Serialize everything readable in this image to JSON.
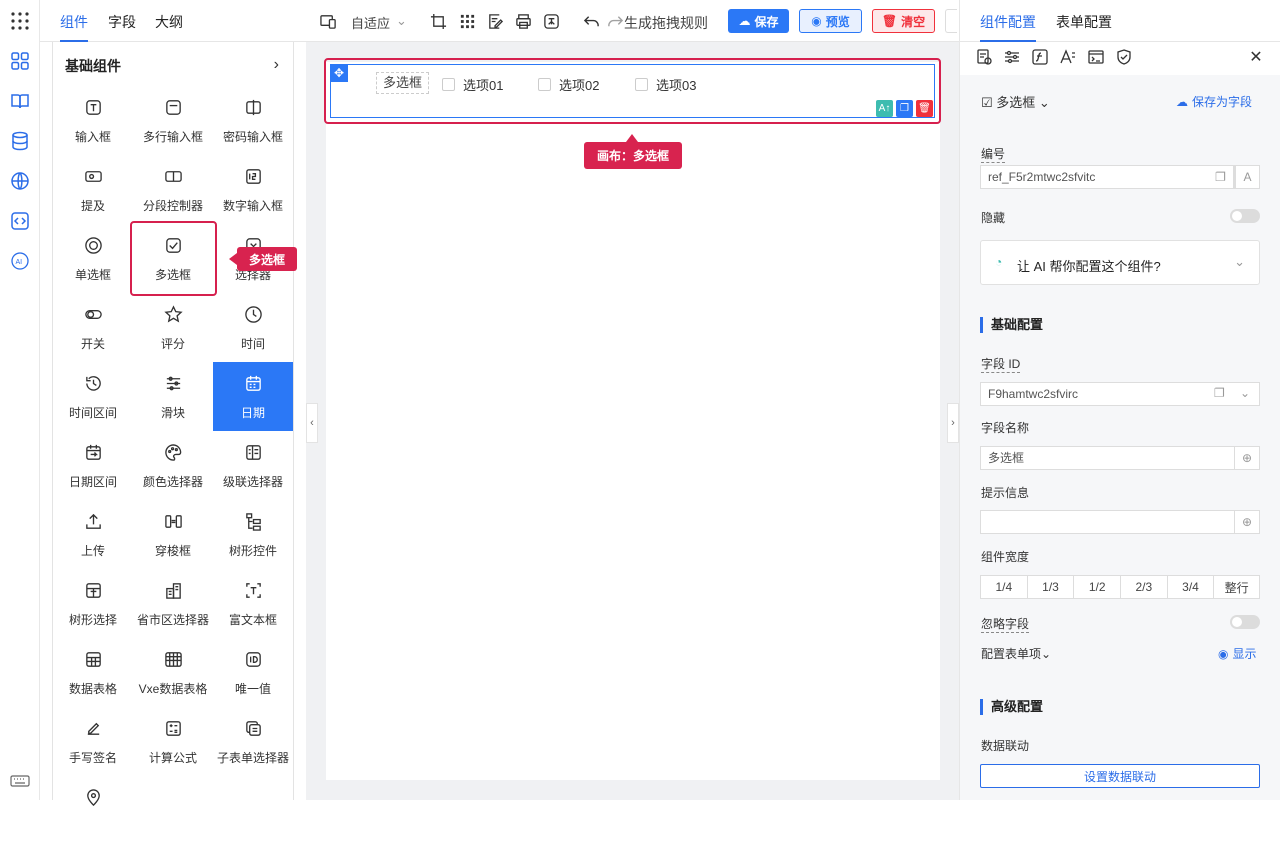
{
  "left_panel": {
    "tabs": [
      "组件",
      "字段",
      "大纲"
    ],
    "group_title": "基础组件",
    "items": [
      "输入框",
      "多行输入框",
      "密码输入框",
      "提及",
      "分段控制器",
      "数字输入框",
      "单选框",
      "多选框",
      "选择器",
      "开关",
      "评分",
      "时间",
      "时间区间",
      "滑块",
      "日期",
      "日期区间",
      "颜色选择器",
      "级联选择器",
      "上传",
      "穿梭框",
      "树形控件",
      "树形选择",
      "省市区选择器",
      "富文本框",
      "数据表格",
      "Vxe数据表格",
      "唯一值",
      "手写签名",
      "计算公式",
      "子表单选择器"
    ],
    "selected_item": "日期"
  },
  "callouts": {
    "palette": "多选框",
    "canvas": "画布：多选框"
  },
  "toolbar": {
    "layout_mode": "自适应",
    "rule_label": "生成拖拽规则",
    "save": "保存",
    "preview": "预览",
    "clear": "清空"
  },
  "canvas": {
    "field_label": "多选框",
    "options": [
      "选项01",
      "选项02",
      "选项03"
    ]
  },
  "right_panel": {
    "tabs": [
      "组件配置",
      "表单配置"
    ],
    "component_type": "多选框",
    "save_as_field": "保存为字段",
    "ref_label": "编号",
    "ref_value": "ref_F5r2mtwc2sfvitc",
    "hidden_label": "隐藏",
    "ai_prompt": "让 AI 帮你配置这个组件?",
    "basic_section": "基础配置",
    "field_id_label": "字段 ID",
    "field_id_value": "F9hamtwc2sfvirc",
    "field_name_label": "字段名称",
    "field_name_value": "多选框",
    "hint_label": "提示信息",
    "hint_value": "",
    "width_label": "组件宽度",
    "width_options": [
      "1/4",
      "1/3",
      "1/2",
      "2/3",
      "3/4",
      "整行"
    ],
    "ignore_label": "忽略字段",
    "config_items_label": "配置表单项",
    "show_label": "显示",
    "advanced_section": "高级配置",
    "linkage_label": "数据联动",
    "linkage_button": "设置数据联动"
  },
  "colors": {
    "primary": "#2b78f6",
    "highlight": "#d6204e",
    "danger": "#f0313c"
  }
}
